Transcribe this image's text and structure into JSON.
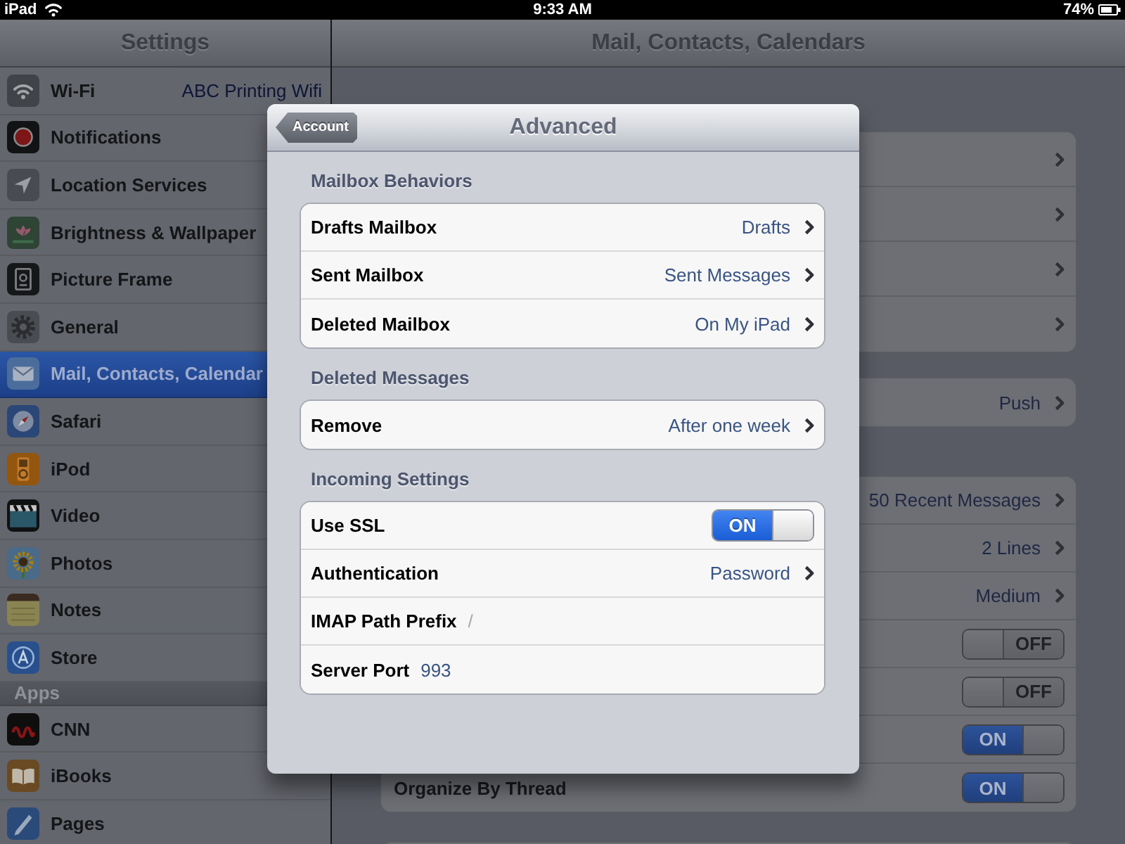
{
  "status_bar": {
    "device": "iPad",
    "time": "9:33 AM",
    "battery": "74%"
  },
  "sidebar": {
    "title": "Settings",
    "groups": [
      {
        "items": [
          {
            "label": "Wi-Fi",
            "value": "ABC Printing Wifi",
            "selected": false
          },
          {
            "label": "Notifications",
            "selected": false
          },
          {
            "label": "Location Services",
            "selected": false
          },
          {
            "label": "Brightness & Wallpaper",
            "selected": false
          },
          {
            "label": "Picture Frame",
            "selected": false
          },
          {
            "label": "General",
            "selected": false
          },
          {
            "label": "Mail, Contacts, Calendar",
            "selected": true
          },
          {
            "label": "Safari",
            "selected": false
          },
          {
            "label": "iPod",
            "selected": false
          },
          {
            "label": "Video",
            "selected": false
          },
          {
            "label": "Photos",
            "selected": false
          },
          {
            "label": "Notes",
            "selected": false
          },
          {
            "label": "Store",
            "selected": false
          }
        ]
      },
      {
        "header": "Apps",
        "items": [
          {
            "label": "CNN",
            "selected": false
          },
          {
            "label": "iBooks",
            "selected": false
          },
          {
            "label": "Pages",
            "selected": false
          }
        ]
      }
    ]
  },
  "detail": {
    "title": "Mail, Contacts, Calendars",
    "groups": [
      {
        "rows": [
          {
            "kind": "link"
          },
          {
            "kind": "link"
          },
          {
            "kind": "link"
          },
          {
            "kind": "link"
          }
        ]
      },
      {
        "rows": [
          {
            "kind": "link",
            "value": "Push"
          }
        ]
      },
      {
        "rows": [
          {
            "kind": "link",
            "value": "50 Recent Messages"
          },
          {
            "kind": "link",
            "value": "2 Lines"
          },
          {
            "kind": "link",
            "value": "Medium"
          },
          {
            "kind": "switch",
            "on": false,
            "text": "OFF"
          },
          {
            "kind": "switch",
            "on": false,
            "text": "OFF"
          },
          {
            "kind": "switch",
            "on": true,
            "text": "ON"
          },
          {
            "kind": "switch",
            "label": "Organize By Thread",
            "on": true,
            "text": "ON"
          }
        ]
      }
    ]
  },
  "popover": {
    "back_button": "Account",
    "title": "Advanced",
    "sections": [
      {
        "header": "Mailbox Behaviors",
        "rows": [
          {
            "kind": "link",
            "label": "Drafts Mailbox",
            "value": "Drafts"
          },
          {
            "kind": "link",
            "label": "Sent Mailbox",
            "value": "Sent Messages"
          },
          {
            "kind": "link",
            "label": "Deleted Mailbox",
            "value": "On My iPad"
          }
        ]
      },
      {
        "header": "Deleted Messages",
        "rows": [
          {
            "kind": "link",
            "label": "Remove",
            "value": "After one week"
          }
        ]
      },
      {
        "header": "Incoming Settings",
        "rows": [
          {
            "kind": "switch",
            "label": "Use SSL",
            "on": true,
            "text": "ON"
          },
          {
            "kind": "link",
            "label": "Authentication",
            "value": "Password"
          },
          {
            "kind": "field",
            "label": "IMAP Path Prefix",
            "placeholder": "/"
          },
          {
            "kind": "field",
            "label": "Server Port",
            "value": "993"
          }
        ]
      }
    ]
  }
}
